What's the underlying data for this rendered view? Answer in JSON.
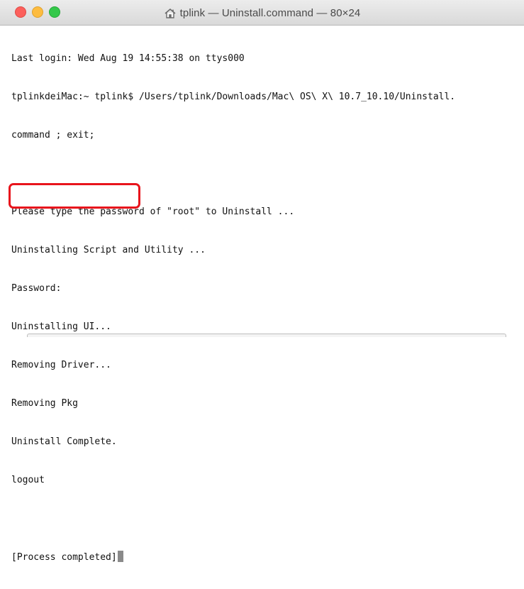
{
  "window": {
    "title": "tplink — Uninstall.command — 80×24",
    "title_icon": "home-icon",
    "controls": {
      "close_color": "#fc605c",
      "minimize_color": "#fdbc40",
      "zoom_color": "#34c84a"
    }
  },
  "terminal": {
    "lines": [
      "Last login: Wed Aug 19 14:55:38 on ttys000",
      "tplinkdeiMac:~ tplink$ /Users/tplink/Downloads/Mac\\ OS\\ X\\ 10.7_10.10/Uninstall.",
      "command ; exit;",
      "",
      "Please type the password of \"root\" to Uninstall ...",
      "Uninstalling Script and Utility ...",
      "Password:",
      "Uninstalling UI...",
      "Removing Driver...",
      "Removing Pkg",
      "Uninstall Complete.",
      "logout",
      ""
    ],
    "process_status": "[Process completed]",
    "highlight_color": "#e8141c"
  }
}
